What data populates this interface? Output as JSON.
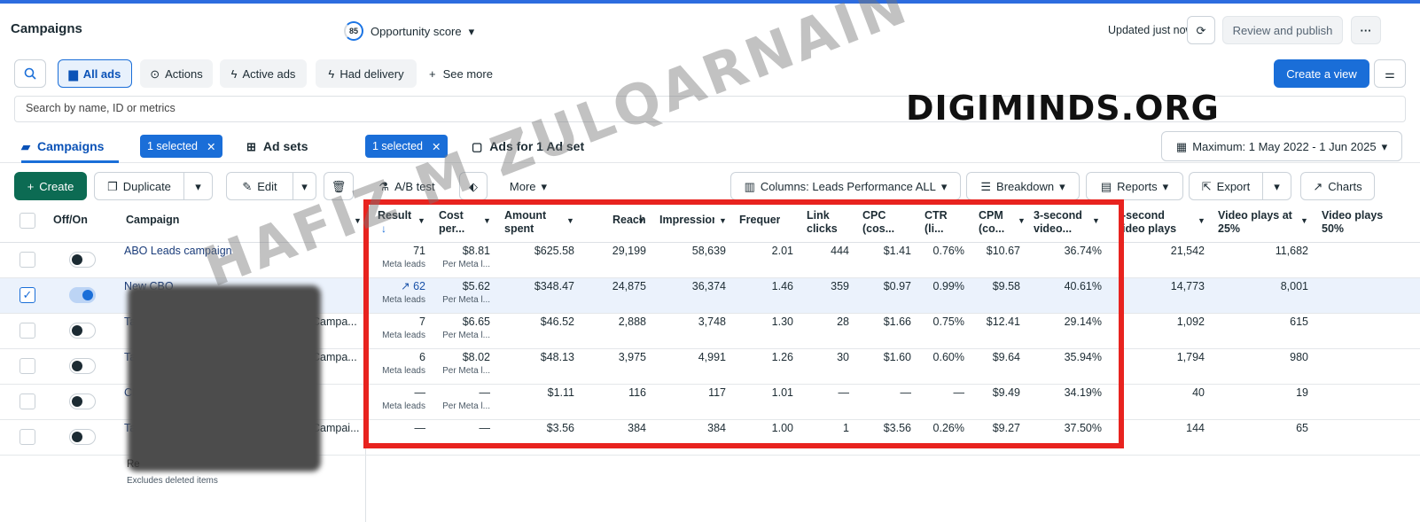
{
  "header": {
    "title": "Campaigns",
    "opportunity_score": "85",
    "opportunity_label": "Opportunity score",
    "updated": "Updated just now",
    "review_label": "Review and publish",
    "more_label": "···"
  },
  "filters": {
    "all_ads": "All ads",
    "actions": "Actions",
    "active_ads": "Active ads",
    "had_delivery": "Had delivery",
    "see_more": "See more",
    "create_view": "Create a view",
    "search_placeholder": "Search by name, ID or metrics"
  },
  "tabs": {
    "campaigns": "Campaigns",
    "campaigns_selected": "1 selected",
    "ad_sets": "Ad sets",
    "ad_sets_selected": "1 selected",
    "ads": "Ads for 1 Ad set",
    "date_range": "Maximum: 1 May 2022 - 1 Jun 2025"
  },
  "toolbar": {
    "create": "Create",
    "duplicate": "Duplicate",
    "edit": "Edit",
    "ab_test": "A/B test",
    "more": "More",
    "columns": "Columns: Leads Performance ALL",
    "breakdown": "Breakdown",
    "reports": "Reports",
    "export": "Export",
    "charts": "Charts"
  },
  "table": {
    "headers": {
      "offon": "Off/On",
      "campaign": "Campaign",
      "result": "Result",
      "cost": "Cost per...",
      "amount": "Amount spent",
      "reach": "Reach",
      "impressions": "Impression",
      "frequency": "Frequer",
      "link_clicks": "Link clicks",
      "cpc": "CPC (cos...",
      "ctr": "CTR (li...",
      "cpm": "CPM (co...",
      "video3s": "3-second video...",
      "video_plays": "-second ideo plays",
      "video25": "Video plays at 25%",
      "video50": "Video plays 50%"
    },
    "rows": [
      {
        "name": "ABO Leads campaign",
        "on": false,
        "selected": false,
        "result": "71",
        "result_sub": "Meta leads",
        "cost": "$8.81",
        "cost_sub": "Per Meta l...",
        "amount": "$625.58",
        "reach": "29,199",
        "impressions": "58,639",
        "frequency": "2.01",
        "link_clicks": "444",
        "cpc": "$1.41",
        "ctr": "0.76%",
        "cpm": "$10.67",
        "video3s": "36.74%",
        "video_plays": "21,542",
        "video25": "11,682",
        "suffix": ""
      },
      {
        "name": "New CBO",
        "on": true,
        "selected": true,
        "result": "62",
        "result_sub": "Meta leads",
        "cost": "$5.62",
        "cost_sub": "Per Meta l...",
        "amount": "$348.47",
        "reach": "24,875",
        "impressions": "36,374",
        "frequency": "1.46",
        "link_clicks": "359",
        "cpc": "$0.97",
        "ctr": "0.99%",
        "cpm": "$9.58",
        "video3s": "40.61%",
        "video_plays": "14,773",
        "video25": "8,001",
        "suffix": ""
      },
      {
        "name": "Ta",
        "on": false,
        "selected": false,
        "result": "7",
        "result_sub": "Meta leads",
        "cost": "$6.65",
        "cost_sub": "Per Meta l...",
        "amount": "$46.52",
        "reach": "2,888",
        "impressions": "3,748",
        "frequency": "1.30",
        "link_clicks": "28",
        "cpc": "$1.66",
        "ctr": "0.75%",
        "cpm": "$12.41",
        "video3s": "29.14%",
        "video_plays": "1,092",
        "video25": "615",
        "suffix": "Campa..."
      },
      {
        "name": "Ta",
        "on": false,
        "selected": false,
        "result": "6",
        "result_sub": "Meta leads",
        "cost": "$8.02",
        "cost_sub": "Per Meta l...",
        "amount": "$48.13",
        "reach": "3,975",
        "impressions": "4,991",
        "frequency": "1.26",
        "link_clicks": "30",
        "cpc": "$1.60",
        "ctr": "0.60%",
        "cpm": "$9.64",
        "video3s": "35.94%",
        "video_plays": "1,794",
        "video25": "980",
        "suffix": "Campa..."
      },
      {
        "name": "CB",
        "on": false,
        "selected": false,
        "result": "—",
        "result_sub": "Meta leads",
        "cost": "—",
        "cost_sub": "Per Meta l...",
        "amount": "$1.11",
        "reach": "116",
        "impressions": "117",
        "frequency": "1.01",
        "link_clicks": "—",
        "cpc": "—",
        "ctr": "—",
        "cpm": "$9.49",
        "video3s": "34.19%",
        "video_plays": "40",
        "video25": "19",
        "suffix": ""
      },
      {
        "name": "Ta",
        "on": false,
        "selected": false,
        "result": "—",
        "result_sub": "",
        "cost": "—",
        "cost_sub": "",
        "amount": "$3.56",
        "reach": "384",
        "impressions": "384",
        "frequency": "1.00",
        "link_clicks": "1",
        "cpc": "$3.56",
        "ctr": "0.26%",
        "cpm": "$9.27",
        "video3s": "37.50%",
        "video_plays": "144",
        "video25": "65",
        "suffix": "Campai..."
      }
    ],
    "footer_title": "Re",
    "footer_note": "Excludes deleted items"
  },
  "overlays": {
    "watermark": "HAFIZ M ZULQARNAIN",
    "brand": "DIGIMINDS.ORG"
  },
  "colors": {
    "accent": "#1a6ed8",
    "create_green": "#0c6b53",
    "highlight_red": "#e8231f"
  }
}
